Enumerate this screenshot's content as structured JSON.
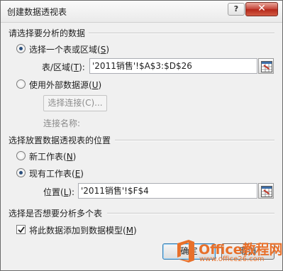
{
  "window": {
    "title": "创建数据透视表",
    "help_label": "?",
    "close_label": "✕"
  },
  "source_section": {
    "title": "请选择要分析的数据",
    "option_table_range": {
      "label": "选择一个表或区域(",
      "key": "S",
      "suffix": ")",
      "selected": true
    },
    "range_label": {
      "text": "表/区域(",
      "key": "T",
      "suffix": "):"
    },
    "range_value": "'2011销售'!$A$3:$D$26",
    "option_external": {
      "label": "使用外部数据源(",
      "key": "U",
      "suffix": ")",
      "selected": false
    },
    "choose_connection_button": "选择连接(C)...",
    "connection_name_label": "连接名称:"
  },
  "location_section": {
    "title": "选择放置数据透视表的位置",
    "option_new_sheet": {
      "label": "新工作表(",
      "key": "N",
      "suffix": ")",
      "selected": false
    },
    "option_existing_sheet": {
      "label": "现有工作表(",
      "key": "E",
      "suffix": ")",
      "selected": true
    },
    "location_label": {
      "text": "位置(",
      "key": "L",
      "suffix": "):"
    },
    "location_value": "'2011销售'!$F$4"
  },
  "multi_section": {
    "title": "选择是否想要分析多个表",
    "add_to_data_model": {
      "label": "将此数据添加到数据模型(",
      "key": "M",
      "suffix": ")",
      "checked": true
    }
  },
  "buttons": {
    "ok_label": "确定",
    "cancel_label": "取消"
  },
  "watermark": {
    "line1": "Office教程网",
    "line2": "www.office26.com"
  },
  "icons": {
    "range_picker": "range-picker-icon",
    "office_logo": "office-logo-icon",
    "checkmark": "checkmark-icon"
  },
  "colors": {
    "close_button": "#c6463a",
    "watermark": "#e8702a",
    "radio_dot": "#2a4e7d"
  }
}
